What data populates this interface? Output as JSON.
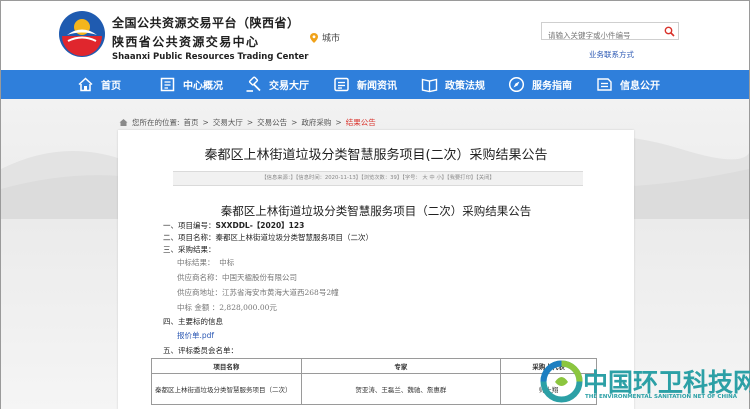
{
  "header": {
    "logo_line1": "全国公共资源交易平台（陕西省）",
    "logo_line2": "陕西省公共资源交易中心",
    "logo_en": "Shaanxi Public Resources Trading Center",
    "city_label": "城市",
    "search_placeholder": "请输入关键字或小件编号",
    "service_link": "业务联系方式"
  },
  "nav": {
    "items": [
      {
        "label": "首页",
        "icon": "home-icon"
      },
      {
        "label": "中心概况",
        "icon": "building-icon"
      },
      {
        "label": "交易大厅",
        "icon": "gavel-icon"
      },
      {
        "label": "新闻资讯",
        "icon": "news-icon"
      },
      {
        "label": "政策法规",
        "icon": "book-icon"
      },
      {
        "label": "服务指南",
        "icon": "compass-icon"
      },
      {
        "label": "信息公开",
        "icon": "info-icon"
      }
    ],
    "color": "#2f7fdb"
  },
  "breadcrumb": {
    "prefix": "您所在的位置:",
    "items": [
      "首页",
      "交易大厅",
      "交易公告",
      "政府采购"
    ],
    "current": "结果公告",
    "sep": ">"
  },
  "article": {
    "title": "秦都区上林街道垃圾分类智慧服务项目(二次）采购结果公告",
    "meta": "【信息来源：】【信息时间：2020-11-13】【浏览次数：39】【字号： 大  中  小】【我要打印】【关闭】",
    "doc_title": "秦都区上林街道垃圾分类智慧服务项目（二次）采购结果公告",
    "item1_label": "一、项目编号：",
    "item1_value": "SXXDDL-【2020】123",
    "item2_label": "二、项目名称：",
    "item2_value": "秦都区上林街道垃圾分类智慧服务项目（二次）",
    "item3_label": "三、采购结果：",
    "result_label": "中标结果：",
    "result_value": "中标",
    "supplier_name_label": "供应商名称：",
    "supplier_name": "中国天楹股份有限公司",
    "supplier_addr_label": "供应商地址：",
    "supplier_addr": "江苏省海安市黄海大道西268号2幢",
    "amount_label": "中标  金额 ：",
    "amount": "2,828,000.00元",
    "item4": "四、主要标的信息",
    "attachment": "报价单.pdf",
    "item5": "五、评标委员会名单："
  },
  "table": {
    "headers": [
      "项目名称",
      "专家",
      "采购人代表"
    ],
    "rows": [
      [
        "秦都区上林街道垃圾分类智慧服务项目（二次）",
        "贺亚涛、王磊兰、魏驰、詹惠群",
        "师上翔"
      ]
    ]
  },
  "watermark": {
    "title": "中国环卫科技网",
    "subtitle": "THE ENVIRONMENTAL SANITATION NET OF CHINA",
    "color": "#2ca0a6"
  }
}
